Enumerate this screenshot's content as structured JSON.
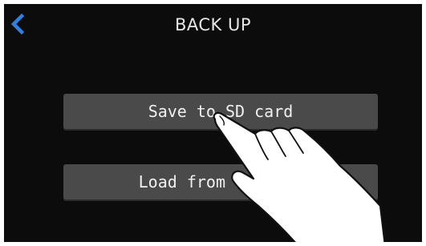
{
  "header": {
    "title": "BACK UP",
    "back_icon": "chevron-left-icon"
  },
  "menu": {
    "save_label": "Save to SD card",
    "load_label": "Load from SD card"
  },
  "colors": {
    "background": "#0c0c0c",
    "accent": "#2f80e0",
    "button": "#4a4a4a",
    "text": "#f0f0f0"
  },
  "overlay": {
    "gesture_icon": "pointing-hand-icon"
  }
}
